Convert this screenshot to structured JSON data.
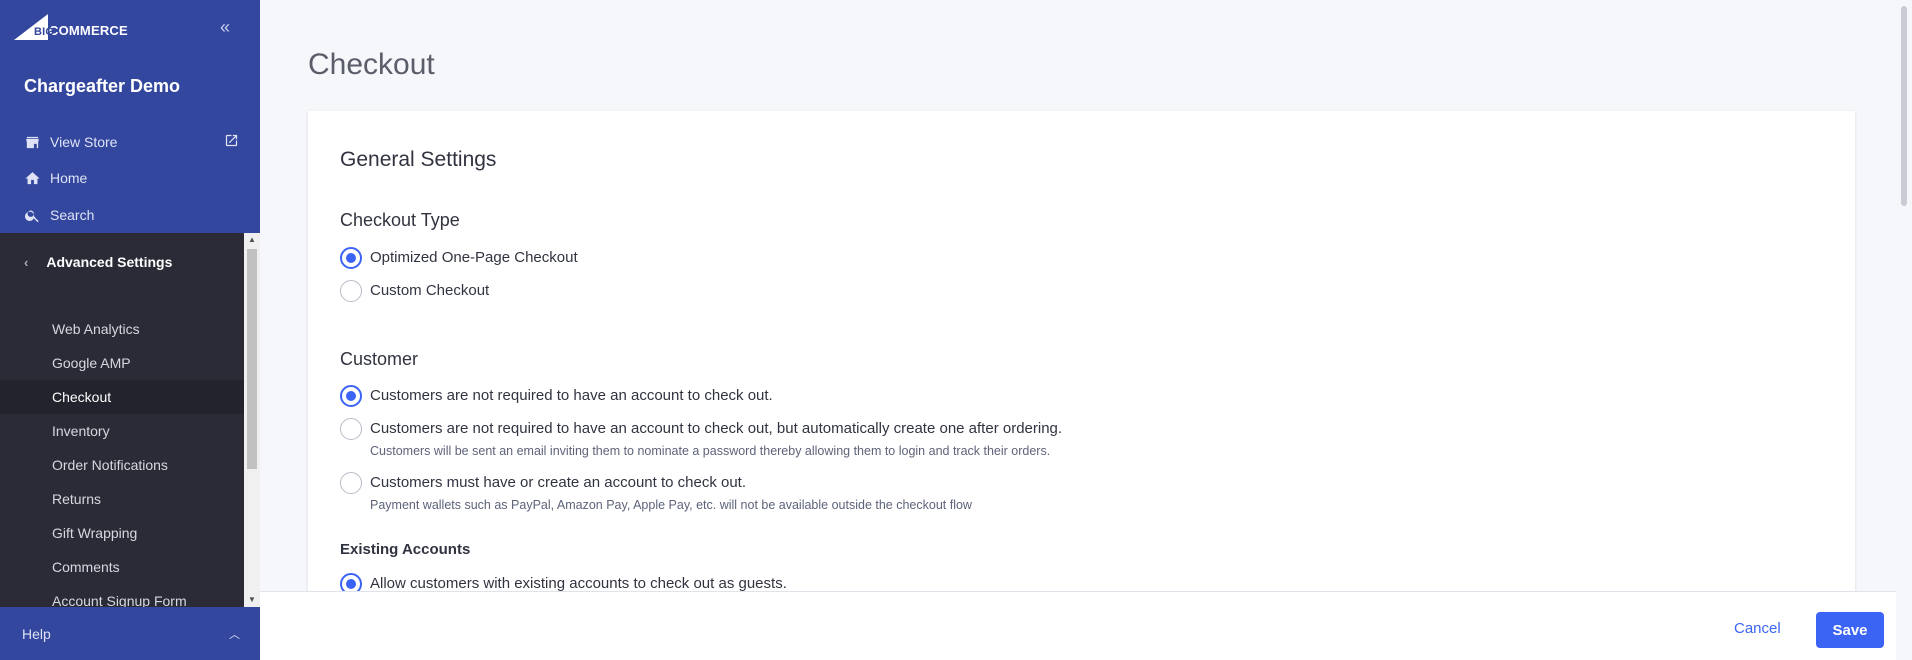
{
  "brand": {
    "logo_big": "BIG",
    "logo_rest": "COMMERCE"
  },
  "sidebar": {
    "store_name": "Chargeafter Demo",
    "links": [
      {
        "label": "View Store",
        "icon": "store-icon"
      },
      {
        "label": "Home",
        "icon": "home-icon"
      },
      {
        "label": "Search",
        "icon": "search-icon"
      }
    ],
    "section_title": "Advanced Settings",
    "menu": [
      {
        "label": "Web Analytics"
      },
      {
        "label": "Google AMP"
      },
      {
        "label": "Checkout",
        "active": true
      },
      {
        "label": "Inventory"
      },
      {
        "label": "Order Notifications"
      },
      {
        "label": "Returns"
      },
      {
        "label": "Gift Wrapping"
      },
      {
        "label": "Comments"
      },
      {
        "label": "Account Signup Form"
      }
    ],
    "help_label": "Help"
  },
  "page": {
    "title": "Checkout",
    "card_title": "General Settings",
    "checkout_type": {
      "title": "Checkout Type",
      "options": [
        {
          "label": "Optimized One-Page Checkout",
          "selected": true
        },
        {
          "label": "Custom Checkout",
          "selected": false
        }
      ]
    },
    "customer": {
      "title": "Customer",
      "options": [
        {
          "label": "Customers are not required to have an account to check out.",
          "selected": true,
          "help": ""
        },
        {
          "label": "Customers are not required to have an account to check out, but automatically create one after ordering.",
          "selected": false,
          "help": "Customers will be sent an email inviting them to nominate a password thereby allowing them to login and track their orders."
        },
        {
          "label": "Customers must have or create an account to check out.",
          "selected": false,
          "help": "Payment wallets such as PayPal, Amazon Pay, Apple Pay, etc. will not be available outside the checkout flow"
        }
      ]
    },
    "existing_accounts": {
      "title": "Existing Accounts",
      "options": [
        {
          "label": "Allow customers with existing accounts to check out as guests.",
          "selected": true
        }
      ]
    }
  },
  "footer": {
    "cancel_label": "Cancel",
    "save_label": "Save"
  },
  "colors": {
    "sidebar_top": "#34479e",
    "sidebar_bottom": "#2a2b36",
    "accent": "#3c64f4"
  }
}
